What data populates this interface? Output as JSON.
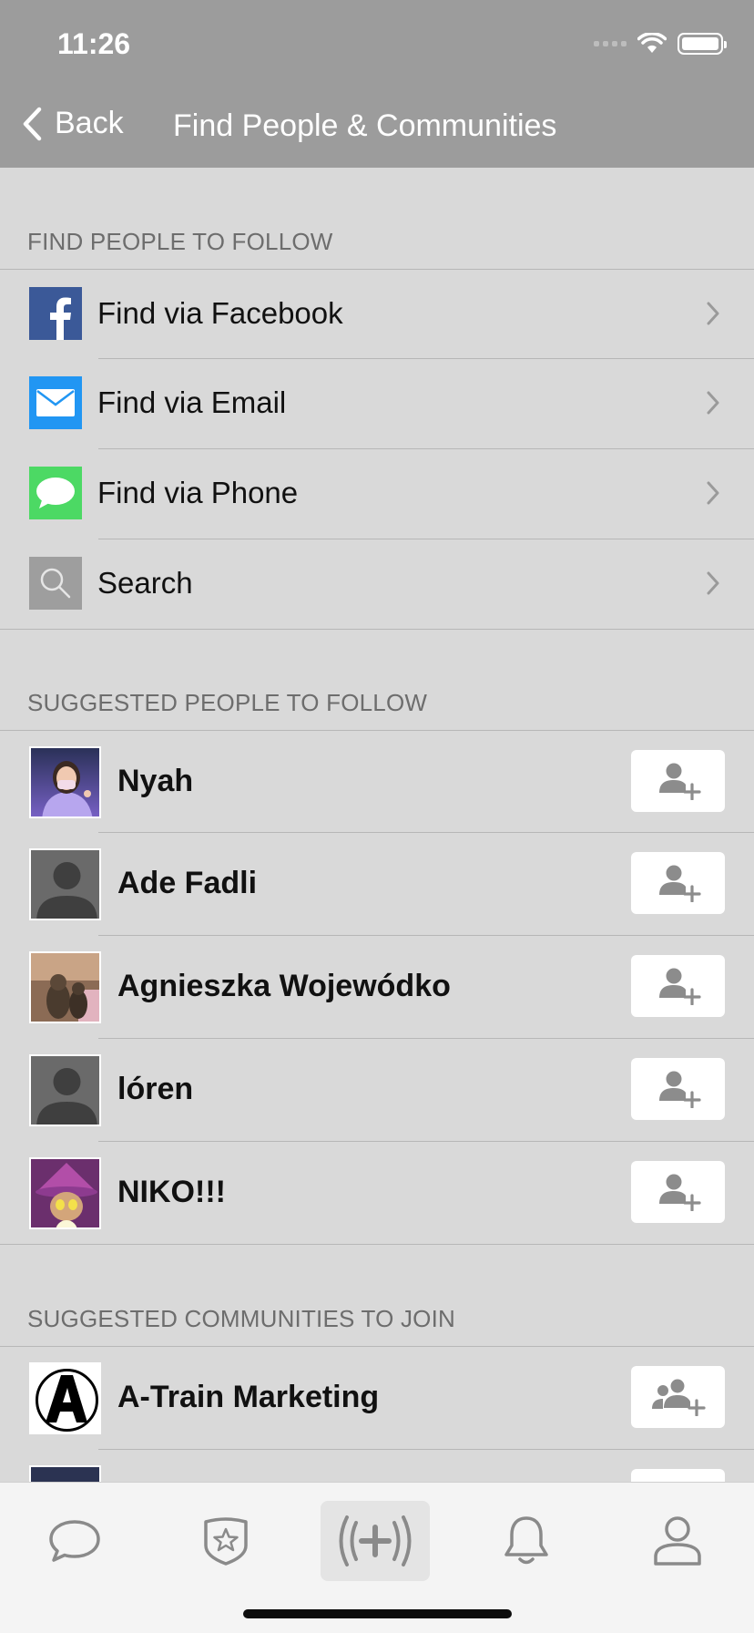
{
  "status_bar": {
    "time": "11:26"
  },
  "nav": {
    "back_label": "Back",
    "title": "Find People & Communities"
  },
  "find_section": {
    "header": "FIND PEOPLE TO FOLLOW",
    "items": [
      {
        "label": "Find via Facebook",
        "icon": "facebook-icon",
        "color": "#3b5998"
      },
      {
        "label": "Find via Email",
        "icon": "envelope-icon",
        "color": "#2196f3"
      },
      {
        "label": "Find via Phone",
        "icon": "message-bubble-icon",
        "color": "#4cd964"
      },
      {
        "label": "Search",
        "icon": "magnifier-icon",
        "color": "#9e9e9e"
      }
    ]
  },
  "people_section": {
    "header": "SUGGESTED PEOPLE TO FOLLOW",
    "people": [
      {
        "name": "Nyah"
      },
      {
        "name": "Ade Fadli"
      },
      {
        "name": "Agnieszka Wojewódko"
      },
      {
        "name": "lóren"
      },
      {
        "name": "NIKO!!!"
      }
    ]
  },
  "communities_section": {
    "header": "SUGGESTED COMMUNITIES TO JOIN",
    "communities": [
      {
        "name": "A-Train Marketing"
      }
    ]
  },
  "tabbar": {
    "tabs": [
      "chat-bubble-icon",
      "star-badge-icon",
      "broadcast-plus-icon",
      "bell-icon",
      "profile-icon"
    ]
  }
}
